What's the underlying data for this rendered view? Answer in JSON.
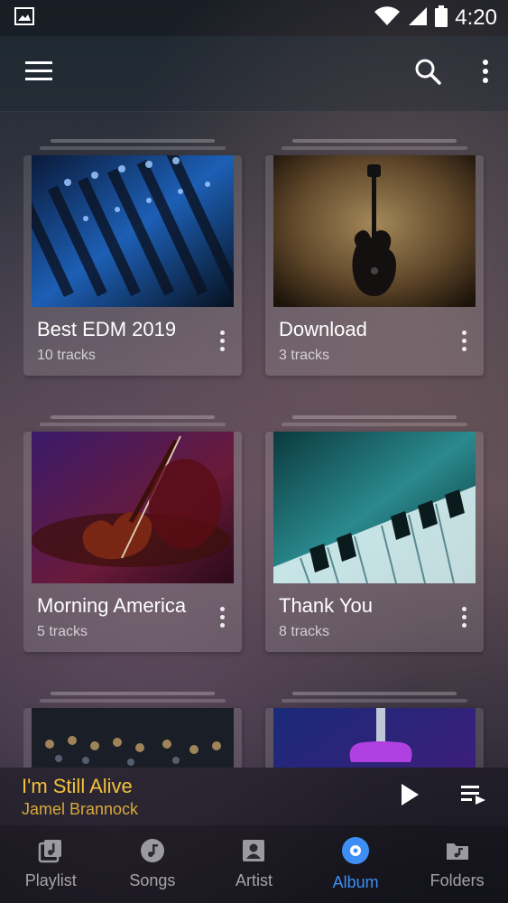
{
  "status_bar": {
    "time": "4:20",
    "left_icon": "image-notification-icon",
    "right_icons": [
      "wifi-icon",
      "signal-icon",
      "battery-icon"
    ]
  },
  "app_bar": {
    "menu_icon": "menu-icon",
    "search_icon": "search-icon",
    "more_icon": "more-vert-icon"
  },
  "albums": [
    {
      "title": "Best EDM 2019",
      "tracks": "10 tracks",
      "art": "mixer-art"
    },
    {
      "title": "Download",
      "tracks": "3 tracks",
      "art": "guitar-art"
    },
    {
      "title": "Morning America",
      "tracks": "5 tracks",
      "art": "violin-art"
    },
    {
      "title": "Thank You",
      "tracks": "8 tracks",
      "art": "piano-art"
    },
    {
      "title": "",
      "tracks": "",
      "art": "orchestra-art"
    },
    {
      "title": "",
      "tracks": "",
      "art": "neon-guitar-art"
    }
  ],
  "mini_player": {
    "title": "I'm Still Alive",
    "artist": "Jamel Brannock"
  },
  "bottom_nav": [
    {
      "label": "Playlist",
      "icon": "playlist-icon",
      "active": false
    },
    {
      "label": "Songs",
      "icon": "music-note-icon",
      "active": false
    },
    {
      "label": "Artist",
      "icon": "artist-icon",
      "active": false
    },
    {
      "label": "Album",
      "icon": "album-icon",
      "active": true
    },
    {
      "label": "Folders",
      "icon": "folder-music-icon",
      "active": false
    }
  ],
  "colors": {
    "accent": "#3d8ff5",
    "now_playing": "#f3c13a"
  }
}
